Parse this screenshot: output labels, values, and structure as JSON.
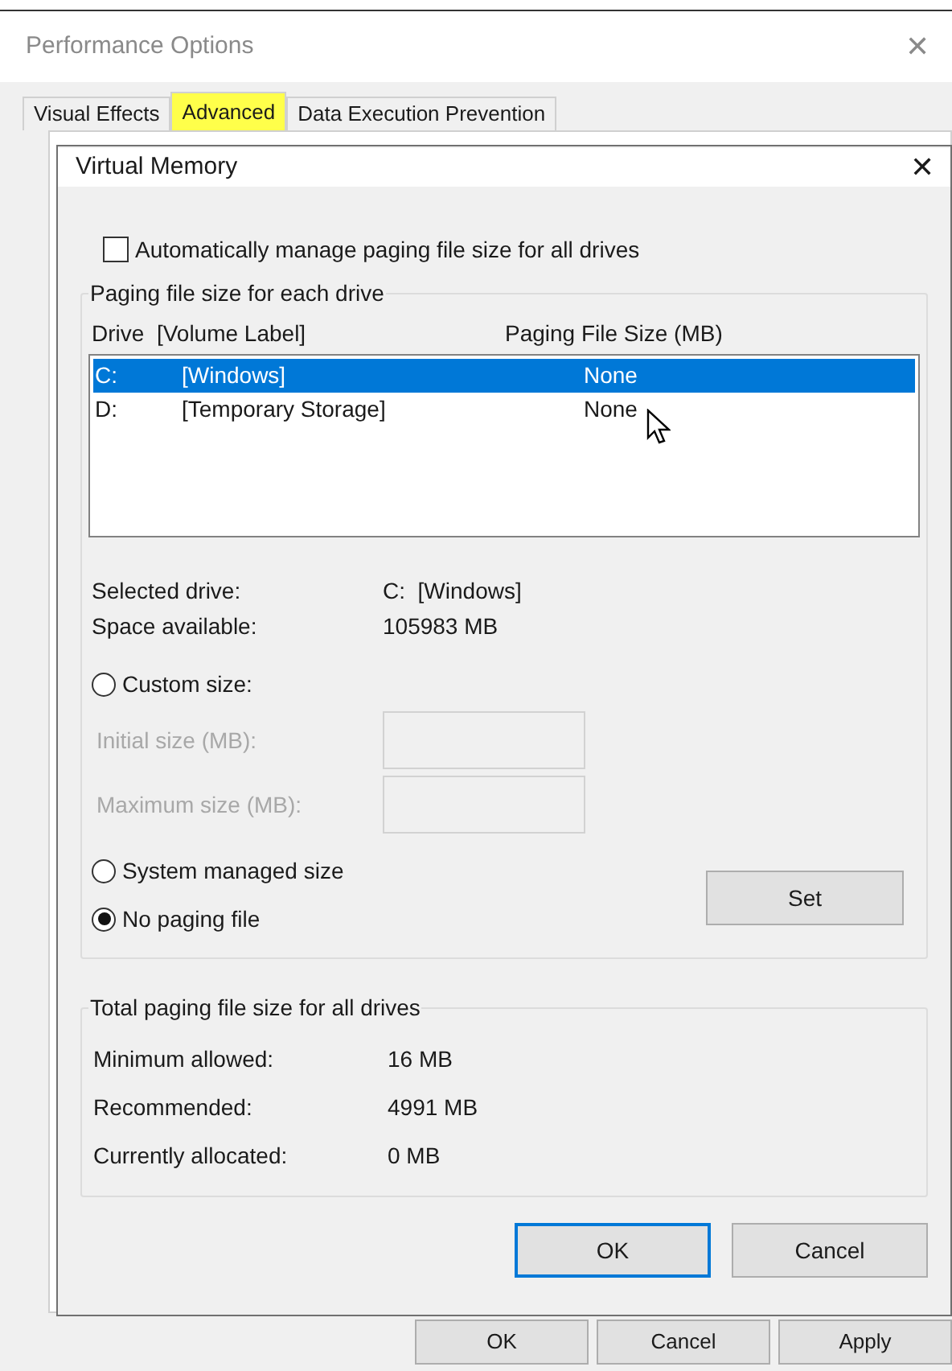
{
  "window": {
    "title": "Performance Options",
    "close": "✕"
  },
  "tabs": [
    {
      "label": "Visual Effects",
      "selected": false,
      "highlighted": false
    },
    {
      "label": "Advanced",
      "selected": true,
      "highlighted": true
    },
    {
      "label": "Data Execution Prevention",
      "selected": false,
      "highlighted": false
    }
  ],
  "window_buttons": [
    "OK",
    "Cancel",
    "Apply"
  ],
  "dialog": {
    "title": "Virtual Memory",
    "close": "✕",
    "auto_manage": {
      "label": "Automatically manage paging file size for all drives",
      "checked": false
    },
    "drives_group": {
      "title": "Paging file size for each drive",
      "columns": [
        "Drive  [Volume Label]",
        "Paging File Size (MB)"
      ],
      "rows": [
        {
          "drive": "C:",
          "label": "[Windows]",
          "size": "None",
          "selected": true
        },
        {
          "drive": "D:",
          "label": "[Temporary Storage]",
          "size": "None",
          "selected": false
        }
      ],
      "info": [
        {
          "label": "Selected drive:",
          "value": "C:  [Windows]"
        },
        {
          "label": "Space available:",
          "value": "105983 MB"
        }
      ],
      "options": [
        {
          "kind": "radio",
          "label": "Custom size:",
          "selected": false
        },
        {
          "kind": "field",
          "label": "Initial size (MB):",
          "disabled": true
        },
        {
          "kind": "field",
          "label": "Maximum size (MB):",
          "disabled": true
        },
        {
          "kind": "radio",
          "label": "System managed size",
          "selected": false
        },
        {
          "kind": "radio",
          "label": "No paging file",
          "selected": true
        }
      ],
      "set_button": "Set"
    },
    "totals_group": {
      "title": "Total paging file size for all drives",
      "rows": [
        {
          "label": "Minimum allowed:",
          "value": "16 MB"
        },
        {
          "label": "Recommended:",
          "value": "4991 MB"
        },
        {
          "label": "Currently allocated:",
          "value": "0 MB"
        }
      ]
    },
    "buttons": [
      {
        "label": "OK",
        "default": true
      },
      {
        "label": "Cancel",
        "default": false
      }
    ]
  }
}
